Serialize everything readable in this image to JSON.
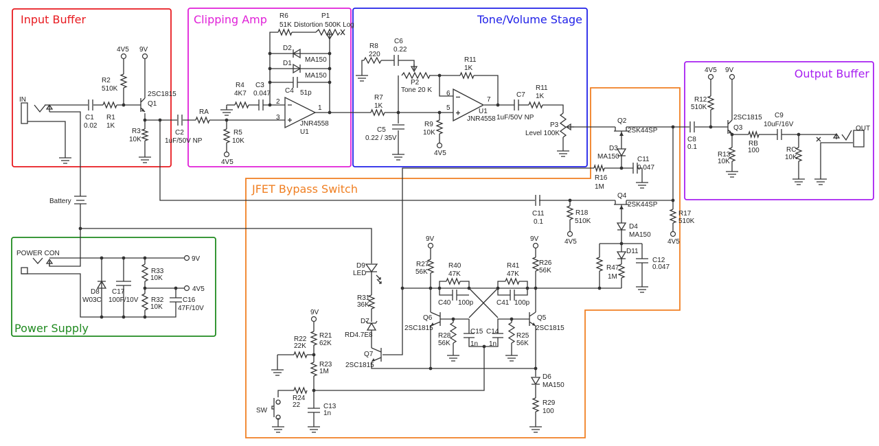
{
  "titles": {
    "input_buffer": "Input Buffer",
    "clipping_amp": "Clipping Amp",
    "tone_volume": "Tone/Volume Stage",
    "output_buffer": "Output Buffer",
    "power_supply": "Power Supply",
    "jfet_bypass": "JFET Bypass Switch"
  },
  "colors": {
    "input_buffer": "#e8191f",
    "clipping_amp": "#e01fd8",
    "tone_volume": "#2020e8",
    "output_buffer": "#a820f0",
    "power_supply": "#1f8a1f",
    "jfet_bypass": "#f07f22"
  },
  "rails": {
    "v45": "4V5",
    "v9": "9V"
  },
  "jacks": {
    "in": "IN",
    "out": "OUT",
    "power": "POWER CON",
    "battery": "Battery",
    "switch": "SW"
  },
  "pins": {
    "u1a": [
      "2",
      "3",
      "1"
    ],
    "u1b": [
      "6",
      "5",
      "7"
    ]
  },
  "components": {
    "C1": {
      "ref": "C1",
      "value": "0.02"
    },
    "R1": {
      "ref": "R1",
      "value": "1K"
    },
    "R2": {
      "ref": "R2",
      "value": "510K"
    },
    "Q1": {
      "ref": "Q1",
      "value": "2SC1815"
    },
    "R3": {
      "ref": "R3",
      "value": "10K"
    },
    "C2": {
      "ref": "C2",
      "value": "1uF/50V NP"
    },
    "RA": {
      "ref": "RA"
    },
    "R5": {
      "ref": "R5",
      "value": "10K"
    },
    "R4": {
      "ref": "R4",
      "value": "4K7"
    },
    "C3": {
      "ref": "C3",
      "value": "0.047"
    },
    "R6": {
      "ref": "R6",
      "value": "51K"
    },
    "P1": {
      "ref": "P1",
      "value": "Distortion 500K Log"
    },
    "D2": {
      "ref": "D2",
      "value": "MA150"
    },
    "D1": {
      "ref": "D1",
      "value": "MA150"
    },
    "C4": {
      "ref": "C4",
      "value": "51p"
    },
    "U1A": {
      "ref": "U1",
      "value": "JNR4558"
    },
    "R8": {
      "ref": "R8",
      "value": "220"
    },
    "C6": {
      "ref": "C6",
      "value": "0.22"
    },
    "P2": {
      "ref": "P2",
      "value": "Tone 20 K"
    },
    "R11a": {
      "ref": "R11",
      "value": "1K"
    },
    "R7": {
      "ref": "R7",
      "value": "1K"
    },
    "C5": {
      "ref": "C5",
      "value": "0.22 / 35V"
    },
    "R9": {
      "ref": "R9",
      "value": "10K"
    },
    "U1B": {
      "ref": "U1",
      "value": "JNR4558"
    },
    "C7": {
      "ref": "C7",
      "value": "1uF/50V NP"
    },
    "R11b": {
      "ref": "R11",
      "value": "1K"
    },
    "P3": {
      "ref": "P3",
      "value": "Level 100K"
    },
    "Q2": {
      "ref": "Q2",
      "value": "2SK44SP"
    },
    "D3": {
      "ref": "D3",
      "value": "MA150"
    },
    "C11a": {
      "ref": "C11",
      "value": "0.047"
    },
    "R16": {
      "ref": "R16",
      "value": "1M"
    },
    "C11b": {
      "ref": "C11",
      "value": "0.1"
    },
    "R18": {
      "ref": "R18",
      "value": "510K"
    },
    "Q4": {
      "ref": "Q4",
      "value": "2SK44SP"
    },
    "R17": {
      "ref": "R17",
      "value": "510K"
    },
    "D4": {
      "ref": "D4",
      "value": "MA150"
    },
    "D11": {
      "ref": "D11"
    },
    "R47": {
      "ref": "R47",
      "value": "1M"
    },
    "C12": {
      "ref": "C12",
      "value": "0.047"
    },
    "R27": {
      "ref": "R27",
      "value": "56K"
    },
    "R40": {
      "ref": "R40",
      "value": "47K"
    },
    "C40": {
      "ref": "C40",
      "value": "100p"
    },
    "R41": {
      "ref": "R41",
      "value": "47K"
    },
    "C41": {
      "ref": "C41",
      "value": "100p"
    },
    "R26": {
      "ref": "R26",
      "value": "56K"
    },
    "Q6": {
      "ref": "Q6",
      "value": "2SC1815"
    },
    "R28": {
      "ref": "R28",
      "value": "56K"
    },
    "C15": {
      "ref": "C15",
      "value": "1n"
    },
    "C14": {
      "ref": "C14",
      "value": "1n"
    },
    "R25": {
      "ref": "R25",
      "value": "56K"
    },
    "Q5": {
      "ref": "Q5",
      "value": "2SC1815"
    },
    "D6": {
      "ref": "D6",
      "value": "MA150"
    },
    "R29": {
      "ref": "R29",
      "value": "100"
    },
    "D9": {
      "ref": "D9",
      "value": "LED"
    },
    "R31": {
      "ref": "R31",
      "value": "36K"
    },
    "D7": {
      "ref": "D7",
      "value": "RD4.7E8"
    },
    "Q7": {
      "ref": "Q7",
      "value": "2SC1815"
    },
    "R21": {
      "ref": "R21",
      "value": "62K"
    },
    "R22": {
      "ref": "R22",
      "value": "22K"
    },
    "R23": {
      "ref": "R23",
      "value": "1M"
    },
    "R24": {
      "ref": "R24",
      "value": "22"
    },
    "C13": {
      "ref": "C13",
      "value": "1n"
    },
    "C8": {
      "ref": "C8",
      "value": "0.1"
    },
    "R12": {
      "ref": "R12",
      "value": "510K"
    },
    "Q3": {
      "ref": "Q3",
      "value": "2SC1815"
    },
    "R13": {
      "ref": "R13",
      "value": "10K"
    },
    "RB": {
      "ref": "RB",
      "value": "100"
    },
    "C9": {
      "ref": "C9",
      "value": "10uF/16V"
    },
    "RC": {
      "ref": "RC",
      "value": "10K"
    },
    "D8": {
      "ref": "D8",
      "value": "W03C"
    },
    "C17": {
      "ref": "C17",
      "value": "100F/10V"
    },
    "R33": {
      "ref": "R33",
      "value": "10K"
    },
    "R32": {
      "ref": "R32",
      "value": "10K"
    },
    "C16": {
      "ref": "C16",
      "value": "47F/10V"
    }
  }
}
